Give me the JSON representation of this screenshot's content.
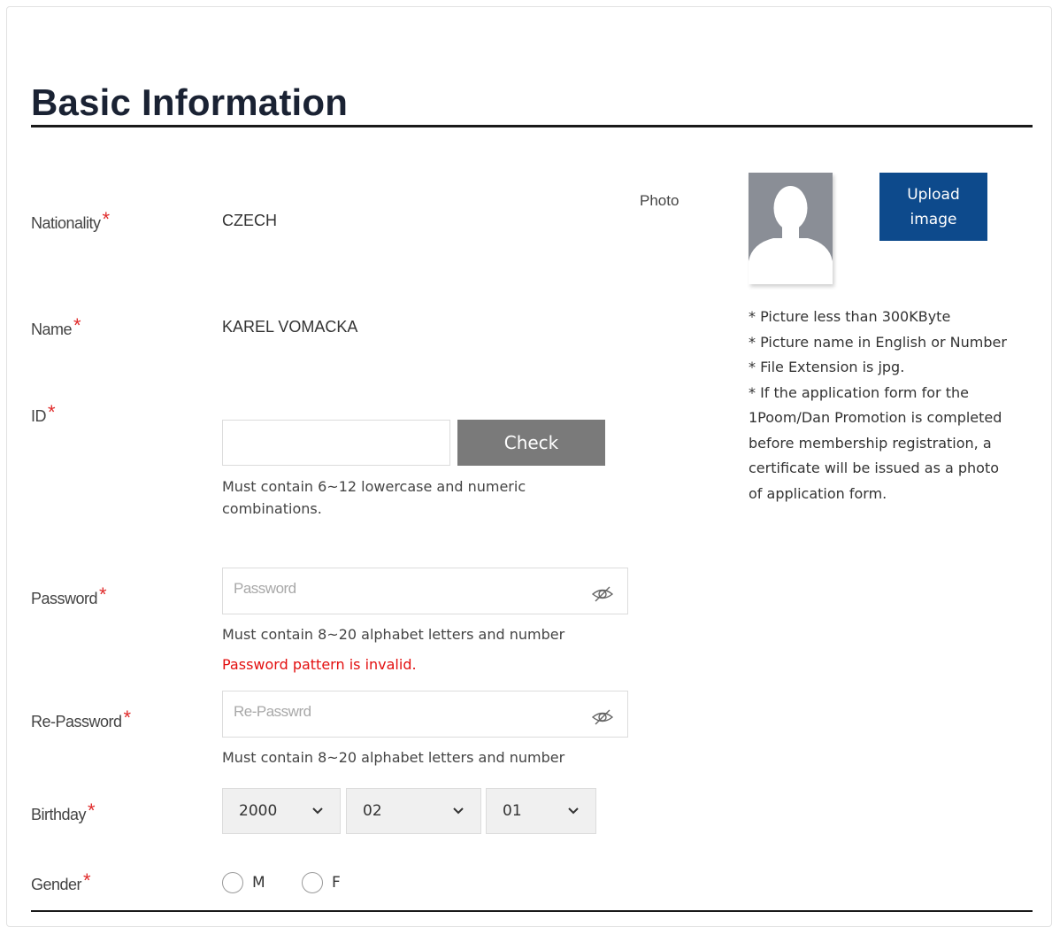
{
  "section": {
    "title": "Basic Information"
  },
  "labels": {
    "nationality": "Nationality",
    "name": "Name",
    "id": "ID",
    "password": "Password",
    "repassword": "Re-Password",
    "birthday": "Birthday",
    "gender": "Gender",
    "required_mark": "*"
  },
  "values": {
    "nationality": "CZECH",
    "name": "KAREL VOMACKA"
  },
  "id_field": {
    "value": "",
    "placeholder": "",
    "check_button": "Check",
    "help": "Must contain 6~12 lowercase and numeric combinations."
  },
  "password_field": {
    "placeholder": "Password",
    "help": "Must contain 8~20 alphabet letters and number",
    "error": "Password pattern is invalid."
  },
  "repassword_field": {
    "placeholder": "Re-Passwrd",
    "help": "Must contain 8~20 alphabet letters and number"
  },
  "birthday": {
    "year": "2000",
    "month": "02",
    "day": "01"
  },
  "gender": {
    "options": [
      "M",
      "F"
    ]
  },
  "photo": {
    "label": "Photo",
    "upload_button": "Upload image",
    "notes": [
      "* Picture less than 300KByte",
      "* Picture name in English or Number",
      "* File Extension is jpg.",
      "* If the application form for the 1Poom/Dan Promotion is completed before membership registration, a certificate will be issued as a photo of application form."
    ]
  },
  "colors": {
    "required": "#e02b2b",
    "error": "#e30f0f",
    "upload_button_bg": "#0d4a8c",
    "check_button_bg": "#7a7a7a",
    "avatar_bg": "#8a8e96"
  }
}
